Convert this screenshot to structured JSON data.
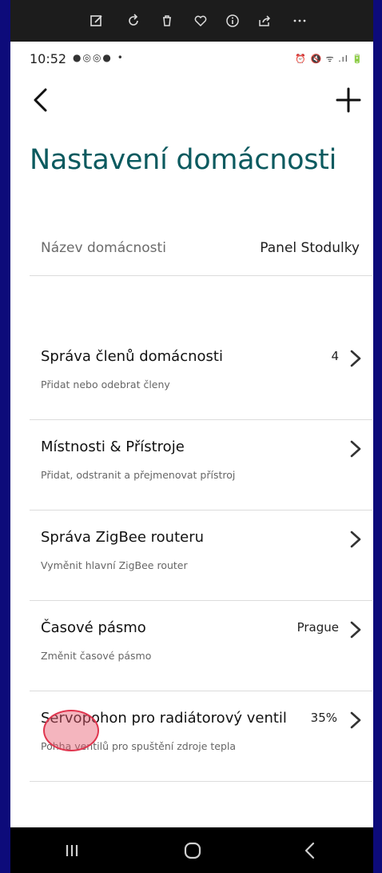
{
  "status_bar": {
    "time": "10:52",
    "notification_dots": "●◎◎● •",
    "system_icons": "⏰ 🔇 ᯤ .ıl 🔋"
  },
  "header": {
    "title": "Nastavení domácnosti"
  },
  "household": {
    "label": "Název domácnosti",
    "value": "Panel Stodulky"
  },
  "menu": {
    "items": [
      {
        "title": "Správa členů domácnosti",
        "subtitle": "Přidat nebo odebrat členy",
        "value": "4"
      },
      {
        "title": "Místnosti & Přístroje",
        "subtitle": "Přidat, odstranit a přejmenovat přístroj",
        "value": ""
      },
      {
        "title": "Správa ZigBee routeru",
        "subtitle": "Vyměnit hlavní ZigBee router",
        "value": ""
      },
      {
        "title": "Časové pásmo",
        "subtitle": "Změnit časové pásmo",
        "value": "Prague"
      },
      {
        "title": "Servopohon pro radiátorový ventil",
        "subtitle": "Pohha ventilů pro spuštění zdroje tepla",
        "value": "35%"
      }
    ]
  },
  "colors": {
    "title": "#0b5a5f",
    "background_frame": "#0d0b7a",
    "touch_indicator": "#e0364f"
  }
}
